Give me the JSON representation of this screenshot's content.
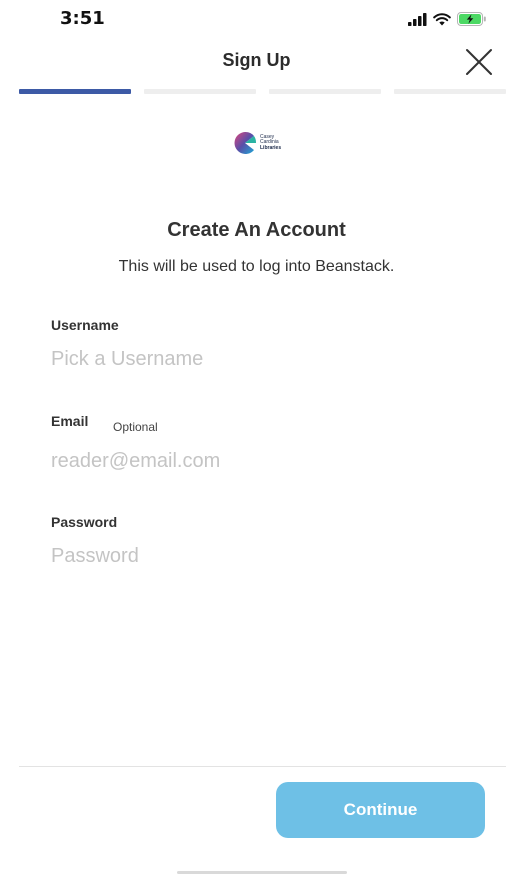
{
  "status_bar": {
    "time": "3:51",
    "icons": [
      "cellular-signal-icon",
      "wifi-icon",
      "battery-charging-icon"
    ],
    "battery_color": "#4cd964"
  },
  "header": {
    "title": "Sign Up",
    "close_icon": "close-icon"
  },
  "progress": {
    "steps": 4,
    "current_step": 1,
    "active_color": "#3d5aa6",
    "inactive_color": "#eeeeee"
  },
  "logo": {
    "lines": [
      "Casey",
      "Cardinia",
      "Libraries"
    ]
  },
  "form": {
    "heading": "Create An Account",
    "subheading": "This will be used to log into Beanstack.",
    "username": {
      "label": "Username",
      "value": "",
      "placeholder": "Pick a Username"
    },
    "email": {
      "label": "Email",
      "optional_label": "Optional",
      "value": "",
      "placeholder": "reader@email.com"
    },
    "password": {
      "label": "Password",
      "value": "",
      "placeholder": "Password"
    }
  },
  "footer": {
    "continue_label": "Continue",
    "continue_color": "#6ec0e6"
  }
}
